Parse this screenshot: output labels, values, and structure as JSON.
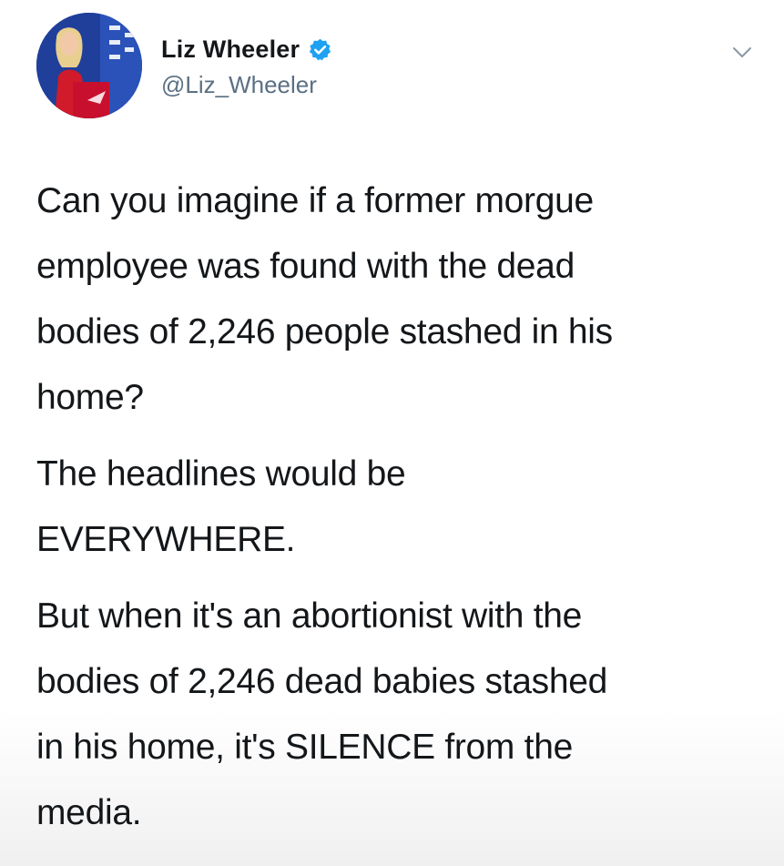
{
  "author": {
    "display_name": "Liz Wheeler",
    "handle": "@Liz_Wheeler",
    "verified": true,
    "verified_icon": "verified-badge-icon",
    "avatar_icon": "profile-photo"
  },
  "menu": {
    "icon": "chevron-down-icon"
  },
  "tweet": {
    "paragraphs": [
      {
        "lines": [
          "Can you imagine if a former morgue",
          "employee was found with the dead",
          "bodies of 2,246 people stashed in his",
          "home?"
        ]
      },
      {
        "lines": [
          "The headlines would be",
          "EVERYWHERE."
        ]
      },
      {
        "lines": [
          "But when it's an abortionist with the",
          "bodies of 2,246 dead babies stashed",
          "in his home, it's SILENCE from the",
          "media."
        ]
      }
    ]
  },
  "colors": {
    "verified_blue": "#1da1f2",
    "handle_gray": "#5b7083",
    "text": "#14171a"
  }
}
